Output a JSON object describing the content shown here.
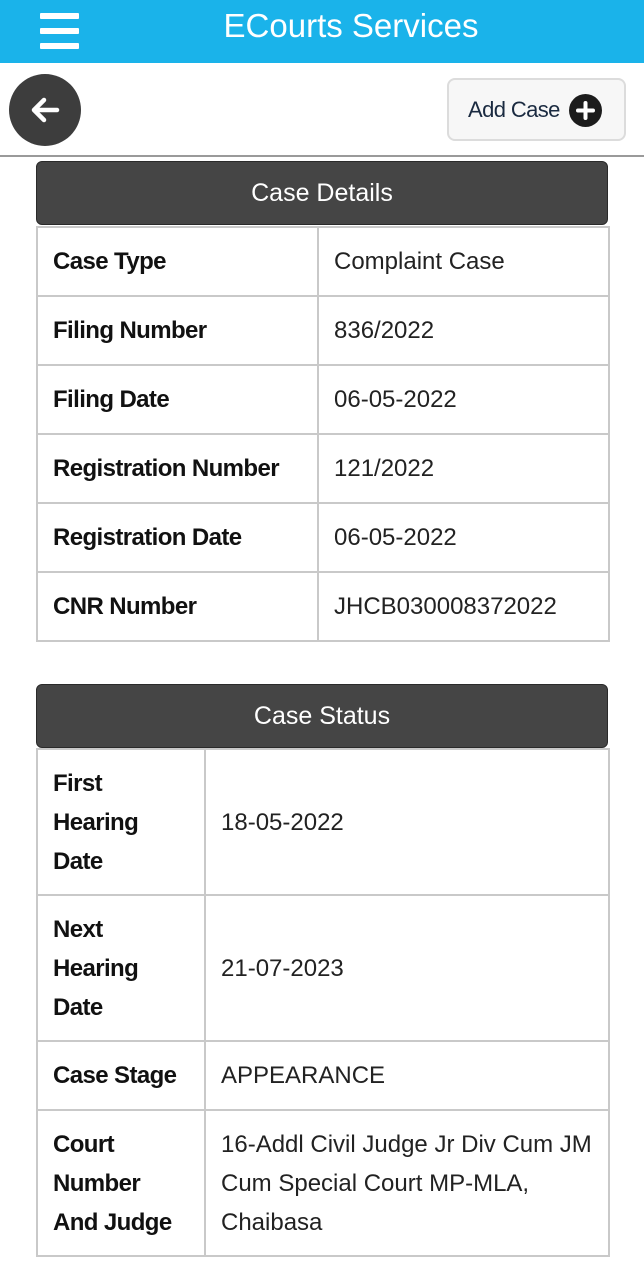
{
  "header": {
    "title": "ECourts Services",
    "menu_icon": "hamburger-menu-icon"
  },
  "toolbar": {
    "back_icon": "arrow-left-icon",
    "add_case_label": "Add Case",
    "add_case_icon": "plus-circle-icon"
  },
  "case_details": {
    "title": "Case Details",
    "rows": [
      {
        "label": "Case Type",
        "value": "Complaint Case"
      },
      {
        "label": "Filing Number",
        "value": "836/2022"
      },
      {
        "label": "Filing Date",
        "value": "06-05-2022"
      },
      {
        "label": "Registration Number",
        "value": "121/2022"
      },
      {
        "label": "Registration Date",
        "value": "06-05-2022"
      },
      {
        "label": "CNR Number",
        "value": "JHCB030008372022"
      }
    ]
  },
  "case_status": {
    "title": "Case Status",
    "rows": [
      {
        "label": "First Hearing Date",
        "value": "18-05-2022"
      },
      {
        "label": "Next Hearing Date",
        "value": "21-07-2023"
      },
      {
        "label": "Case Stage",
        "value": "APPEARANCE"
      },
      {
        "label": "Court Number And Judge",
        "value": "16-Addl Civil Judge Jr Div Cum JM Cum Special Court MP-MLA, Chaibasa"
      }
    ]
  },
  "colors": {
    "header_bg": "#1ab3ea",
    "section_header_bg": "#454545",
    "back_button_bg": "#3d3d3d"
  }
}
